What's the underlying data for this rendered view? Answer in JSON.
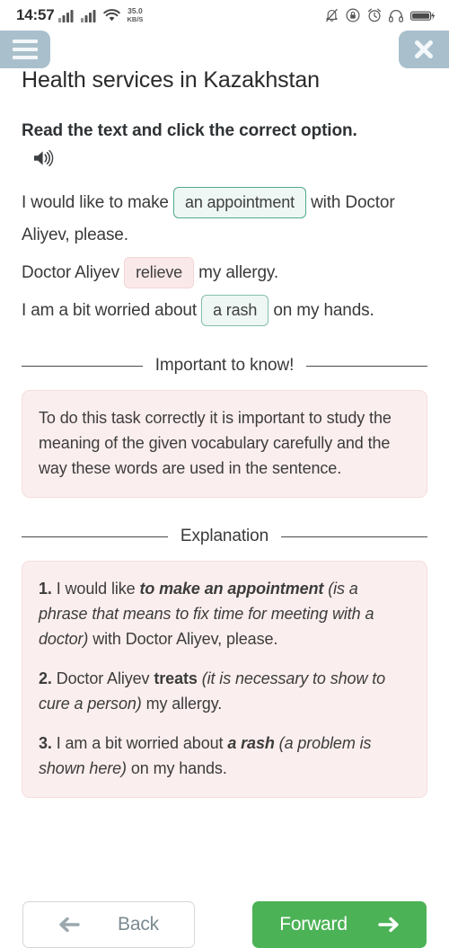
{
  "statusbar": {
    "time": "14:57",
    "network_speed": "35.0",
    "network_unit": "KB/S",
    "icons": [
      "signal-icon",
      "signal-icon",
      "wifi-icon",
      "bell-off-icon",
      "lock-circle-icon",
      "alarm-clock-icon",
      "headphones-icon",
      "battery-charging-icon"
    ]
  },
  "chrome": {
    "menu_label": "hamburger-menu",
    "close_label": "close"
  },
  "header": {
    "title": "Health services in Kazakhstan"
  },
  "task": {
    "prompt": "Read the text and click the correct option.",
    "audio_icon": "speaker-icon"
  },
  "exercise": {
    "sentences": [
      {
        "before": "I would like to make ",
        "blank": "an appointment",
        "blank_state": "correct",
        "after": " with Doctor Aliyev, please."
      },
      {
        "before": "Doctor Aliyev ",
        "blank": "relieve",
        "blank_state": "wrong",
        "after": " my allergy."
      },
      {
        "before": "I am a bit worried about ",
        "blank": "a rash",
        "blank_state": "correct",
        "after": " on my hands."
      }
    ]
  },
  "important": {
    "heading": "Important to know!",
    "body": "To do this task correctly it is important to study the meaning of the given vocabulary carefully and the way these words are used in the sentence."
  },
  "explanation": {
    "heading": "Explanation",
    "items": [
      {
        "num": "1. ",
        "lead": "I would like ",
        "phrase": "to make an appointment",
        "phrase_style": "bold-italic",
        "paren": "(is a phrase that means to fix time for meeting with a doctor)",
        "tail": " with Doctor Aliyev, please."
      },
      {
        "num": "2. ",
        "lead": "Doctor Aliyev ",
        "phrase": "treats",
        "phrase_style": "bold",
        "paren": "(it is necessary to show to cure a person)",
        "tail": " my allergy."
      },
      {
        "num": "3. ",
        "lead": "I am a bit worried about ",
        "phrase": "a rash",
        "phrase_style": "bold-italic",
        "paren": "(a problem is shown here)",
        "tail": " on my hands."
      }
    ]
  },
  "footer": {
    "back_label": "Back",
    "forward_label": "Forward",
    "back_icon": "arrow-left-icon",
    "forward_icon": "arrow-right-icon"
  },
  "colors": {
    "accent_green": "#4cb256",
    "chrome_blue": "#a9c0cc",
    "correct_bg": "#eef7f3",
    "correct_border": "#51a98f",
    "wrong_bg": "#fae9e9",
    "panel_bg": "#fbeeee"
  }
}
